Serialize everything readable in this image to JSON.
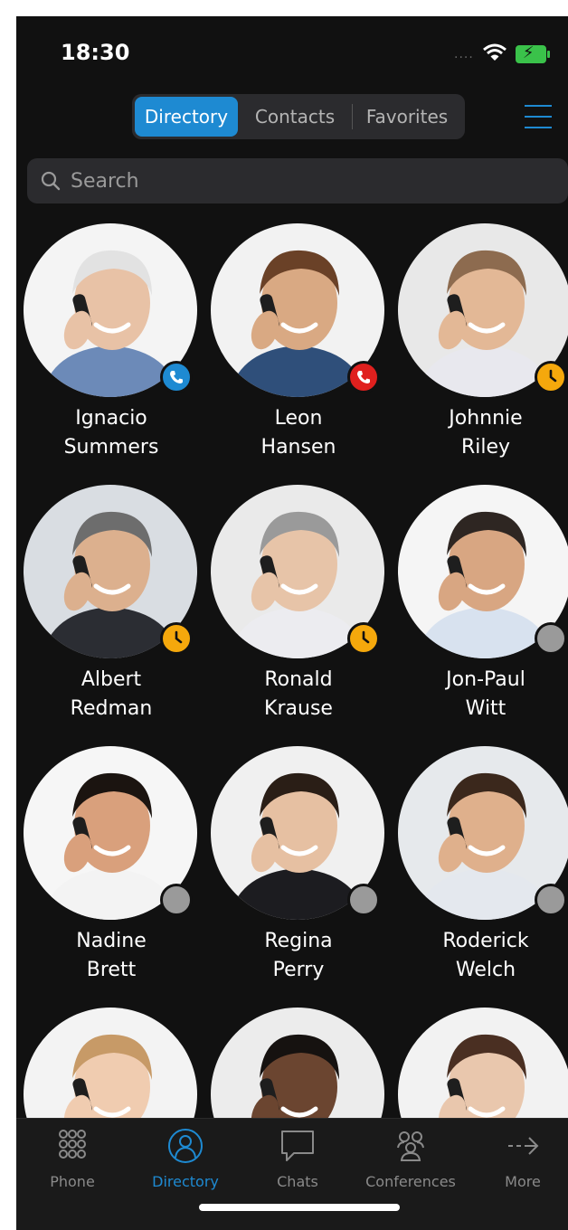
{
  "status_bar": {
    "time": "18:30",
    "signal": "...."
  },
  "segments": [
    {
      "label": "Directory",
      "active": true
    },
    {
      "label": "Contacts",
      "active": false
    },
    {
      "label": "Favorites",
      "active": false
    }
  ],
  "search": {
    "placeholder": "Search"
  },
  "colors": {
    "accent": "#1e8ad2",
    "call_red": "#e0201e",
    "away_yellow": "#f5a80c",
    "offline_grey": "#9a9a9a"
  },
  "contacts": [
    {
      "first": "Ignacio",
      "last": "Summers",
      "status": "on-call",
      "status_color": "#1e8ad2"
    },
    {
      "first": "Leon",
      "last": "Hansen",
      "status": "busy-call",
      "status_color": "#e0201e"
    },
    {
      "first": "Johnnie",
      "last": "Riley",
      "status": "away",
      "status_color": "#f5a80c"
    },
    {
      "first": "Albert",
      "last": "Redman",
      "status": "away",
      "status_color": "#f5a80c"
    },
    {
      "first": "Ronald",
      "last": "Krause",
      "status": "away",
      "status_color": "#f5a80c"
    },
    {
      "first": "Jon-Paul",
      "last": "Witt",
      "status": "offline",
      "status_color": "#9a9a9a"
    },
    {
      "first": "Nadine",
      "last": "Brett",
      "status": "offline",
      "status_color": "#9a9a9a"
    },
    {
      "first": "Regina",
      "last": "Perry",
      "status": "offline",
      "status_color": "#9a9a9a"
    },
    {
      "first": "Roderick",
      "last": "Welch",
      "status": "offline",
      "status_color": "#9a9a9a"
    },
    {
      "first": "",
      "last": "",
      "status": "",
      "status_color": ""
    },
    {
      "first": "",
      "last": "",
      "status": "",
      "status_color": ""
    },
    {
      "first": "",
      "last": "",
      "status": "",
      "status_color": ""
    }
  ],
  "tabs": [
    {
      "label": "Phone",
      "icon": "dialpad-icon",
      "active": false
    },
    {
      "label": "Directory",
      "icon": "person-icon",
      "active": true
    },
    {
      "label": "Chats",
      "icon": "chat-bubble-icon",
      "active": false
    },
    {
      "label": "Conferences",
      "icon": "group-icon",
      "active": false
    },
    {
      "label": "More",
      "icon": "arrow-right-icon",
      "active": false
    }
  ]
}
